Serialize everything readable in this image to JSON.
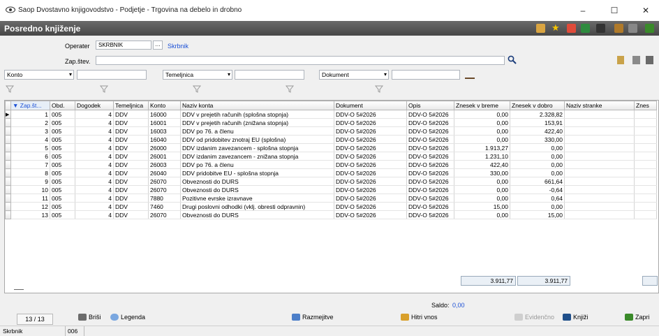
{
  "window": {
    "title": "Saop Dvostavno knjigovodstvo - Podjetje - Trgovina na debelo in drobno",
    "minimize": "–",
    "maximize": "☐",
    "close": "✕"
  },
  "header": {
    "title": "Posredno knjiženje"
  },
  "form": {
    "operater_label": "Operater",
    "operater_value": "SKRBNIK",
    "operater_button": "…",
    "operater_name": "Skrbnik",
    "zapstev_label": "Zap.štev.",
    "zapstev_value": ""
  },
  "filters": [
    {
      "field": "Konto",
      "value": ""
    },
    {
      "field": "Temeljnica",
      "value": ""
    },
    {
      "field": "Dokument",
      "value": ""
    }
  ],
  "table": {
    "columns": [
      "▼ Zap.št...",
      "Obd.",
      "Dogodek",
      "Temeljnica",
      "Konto",
      "Naziv konta",
      "Dokument",
      "Opis",
      "Znesek v breme",
      "Znesek v dobro",
      "Naziv stranke",
      "Znes"
    ],
    "rows": [
      [
        "1",
        "005",
        "4",
        "DDV",
        "16000",
        "DDV v prejetih računih (splošna stopnja)",
        "DDV-O 5#2026",
        "DDV-O 5#2026",
        "0,00",
        "2.328,82",
        ""
      ],
      [
        "2",
        "005",
        "4",
        "DDV",
        "16001",
        "DDV v prejetih računih (znižana stopnja)",
        "DDV-O 5#2026",
        "DDV-O 5#2026",
        "0,00",
        "153,91",
        ""
      ],
      [
        "3",
        "005",
        "4",
        "DDV",
        "16003",
        "DDV po 76. a členu",
        "DDV-O 5#2026",
        "DDV-O 5#2026",
        "0,00",
        "422,40",
        ""
      ],
      [
        "4",
        "005",
        "4",
        "DDV",
        "16040",
        "DDV od pridobitev znotraj EU (splošna)",
        "DDV-O 5#2026",
        "DDV-O 5#2026",
        "0,00",
        "330,00",
        ""
      ],
      [
        "5",
        "005",
        "4",
        "DDV",
        "26000",
        "DDV izdanim zavezancem - splošna stopnja",
        "DDV-O 5#2026",
        "DDV-O 5#2026",
        "1.913,27",
        "0,00",
        ""
      ],
      [
        "6",
        "005",
        "4",
        "DDV",
        "26001",
        "DDV izdanim zavezancem - znižana stopnja",
        "DDV-O 5#2026",
        "DDV-O 5#2026",
        "1.231,10",
        "0,00",
        ""
      ],
      [
        "7",
        "005",
        "4",
        "DDV",
        "26003",
        "DDV po 76. a členu",
        "DDV-O 5#2026",
        "DDV-O 5#2026",
        "422,40",
        "0,00",
        ""
      ],
      [
        "8",
        "005",
        "4",
        "DDV",
        "26040",
        "DDV pridobitve EU - splošna stopnja",
        "DDV-O 5#2026",
        "DDV-O 5#2026",
        "330,00",
        "0,00",
        ""
      ],
      [
        "9",
        "005",
        "4",
        "DDV",
        "26070",
        "Obveznosti do DURS",
        "DDV-O 5#2026",
        "DDV-O 5#2026",
        "0,00",
        "661,64",
        ""
      ],
      [
        "10",
        "005",
        "4",
        "DDV",
        "26070",
        "Obveznosti do DURS",
        "DDV-O 5#2026",
        "DDV-O 5#2026",
        "0,00",
        "-0,64",
        ""
      ],
      [
        "11",
        "005",
        "4",
        "DDV",
        "7880",
        "Pozitivne evrske izravnave",
        "DDV-O 5#2026",
        "DDV-O 5#2026",
        "0,00",
        "0,64",
        ""
      ],
      [
        "12",
        "005",
        "4",
        "DDV",
        "7460",
        "Drugi poslovni odhodki (vklj. obresti odpravnin)",
        "DDV-O 5#2026",
        "DDV-O 5#2026",
        "15,00",
        "0,00",
        ""
      ],
      [
        "13",
        "005",
        "4",
        "DDV",
        "26070",
        "Obveznosti do DURS",
        "DDV-O 5#2026",
        "DDV-O 5#2026",
        "0,00",
        "15,00",
        ""
      ]
    ],
    "total_breme": "3.911,77",
    "total_dobro": "3.911,77"
  },
  "saldo": {
    "label": "Saldo:",
    "value": "0,00"
  },
  "bottom": {
    "record_counter": "13 / 13",
    "brisi": "Briši",
    "legenda": "Legenda",
    "razmejitve": "Razmejitve",
    "hitri_vnos": "Hitri vnos",
    "evidencno": "Evidenčno",
    "knjizi": "Knjiži",
    "zapri": "Zapri"
  },
  "statusbar": {
    "user": "Skrbnik",
    "code": "006"
  }
}
